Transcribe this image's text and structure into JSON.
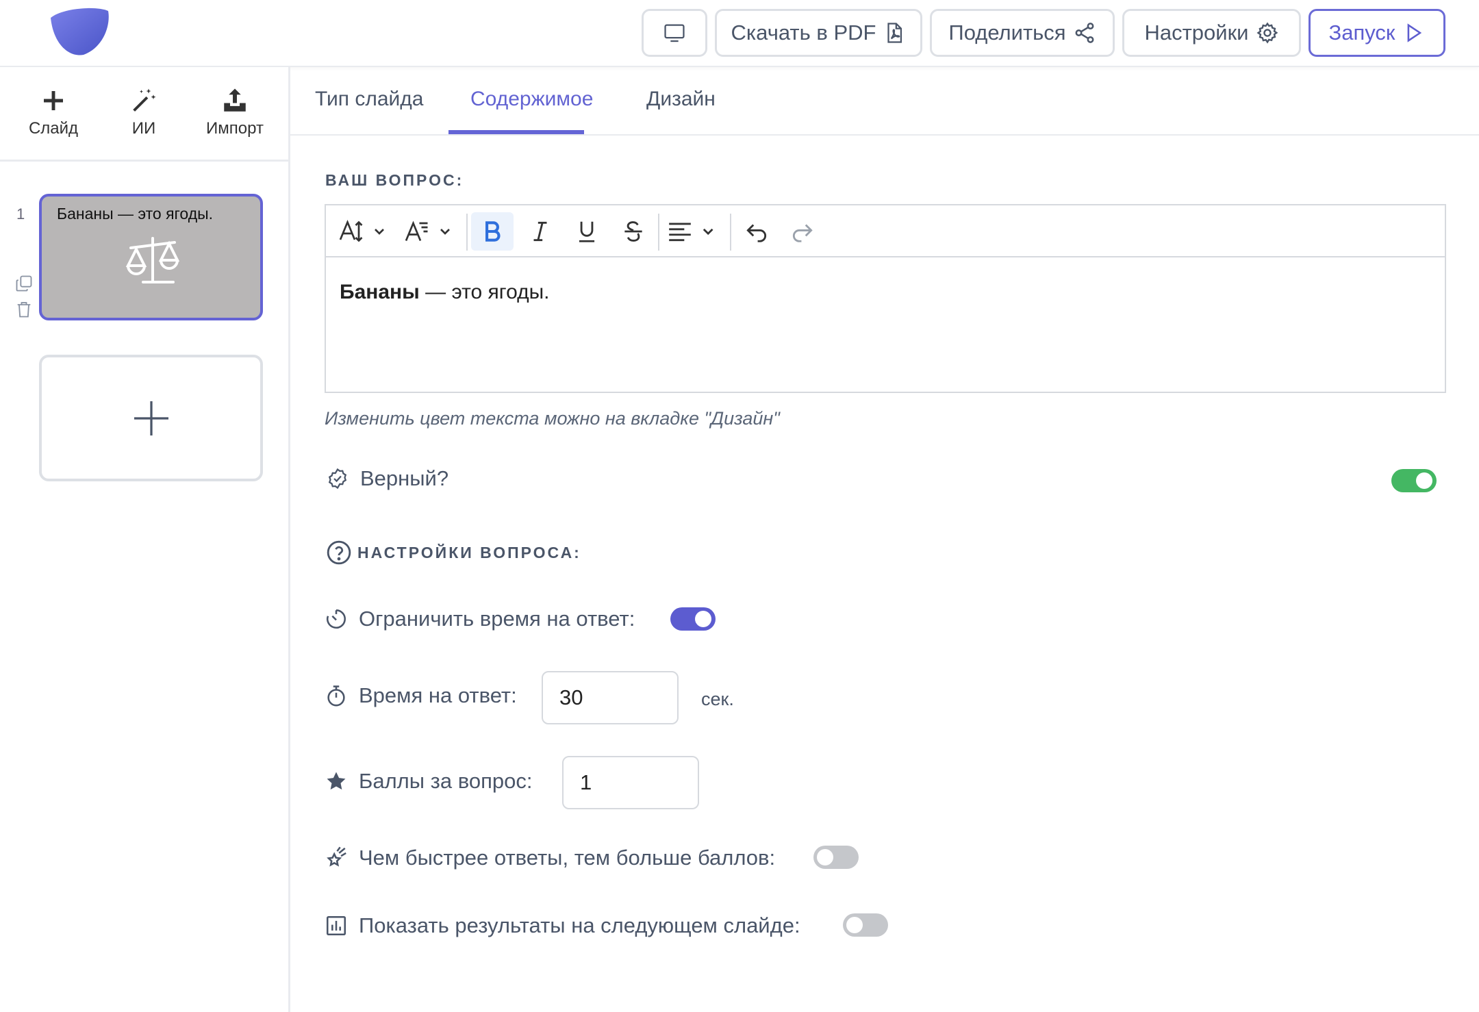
{
  "topbar": {
    "pdf_label": "Скачать в PDF",
    "share_label": "Поделиться",
    "settings_label": "Настройки",
    "launch_label": "Запуск"
  },
  "sidebar": {
    "tools": [
      {
        "label": "Слайд",
        "icon": "plus-icon"
      },
      {
        "label": "ИИ",
        "icon": "magic-wand-icon"
      },
      {
        "label": "Импорт",
        "icon": "upload-icon"
      }
    ],
    "slides": [
      {
        "number": "1",
        "title": "Бананы — это ягоды.",
        "icon": "scales-icon"
      }
    ]
  },
  "tabs": [
    {
      "label": "Тип слайда"
    },
    {
      "label": "Содержимое",
      "active": true
    },
    {
      "label": "Дизайн"
    }
  ],
  "question": {
    "section_label": "ВАШ ВОПРОС:",
    "bold_text": "Бананы",
    "rest_text": " — это ягоды.",
    "hint": "Изменить цвет текста можно на вкладке \"Дизайн\""
  },
  "correct": {
    "label": "Верный?",
    "value": true
  },
  "settings": {
    "section_label": "НАСТРОЙКИ ВОПРОСА:",
    "time_limit": {
      "label": "Ограничить время на ответ:",
      "value": true
    },
    "answer_time": {
      "label": "Время на ответ:",
      "value": "30",
      "unit": "сек."
    },
    "points": {
      "label": "Баллы за вопрос:",
      "value": "1"
    },
    "speed_bonus": {
      "label": "Чем быстрее ответы, тем больше баллов:",
      "value": false
    },
    "show_results": {
      "label": "Показать результаты на следующем слайде:",
      "value": false
    }
  },
  "colors": {
    "accent": "#6263d2",
    "toggle_green": "#44b763",
    "toggle_blue": "#5c5cd0",
    "toggle_off": "#c5c7cb"
  }
}
